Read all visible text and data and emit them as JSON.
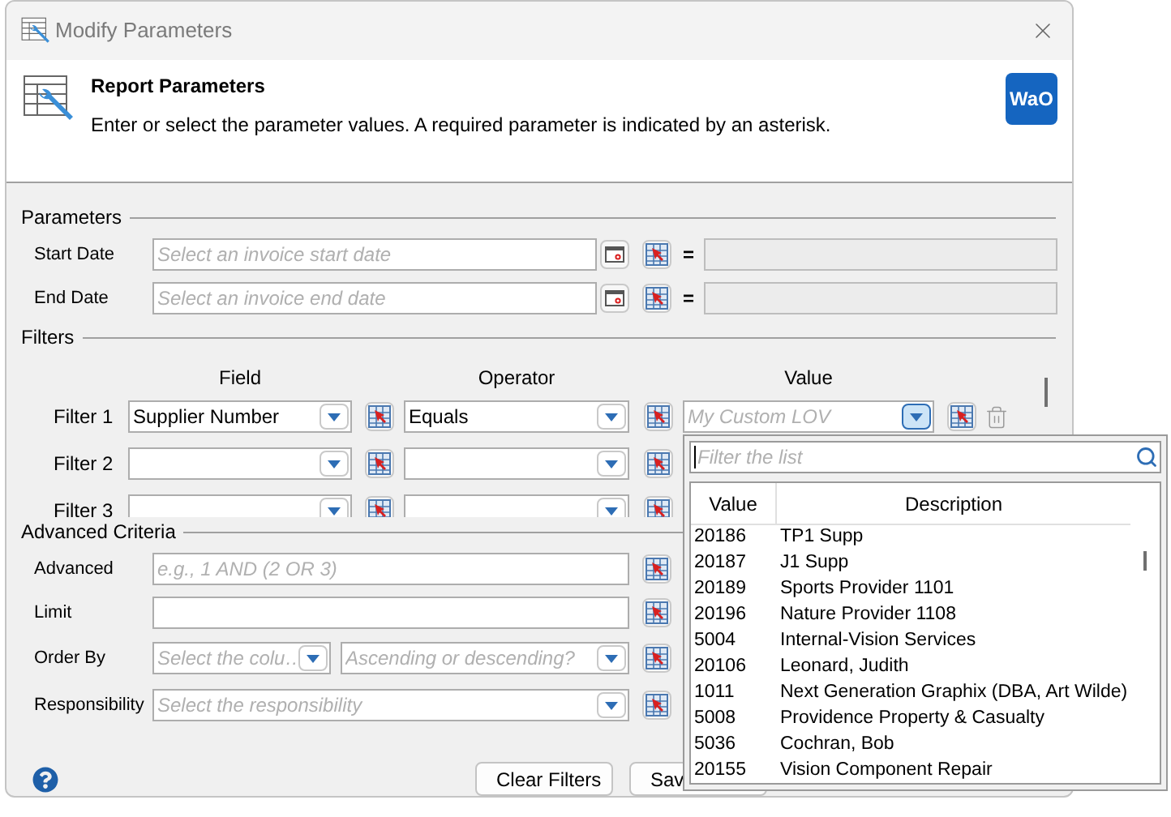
{
  "window": {
    "title": "Modify Parameters"
  },
  "header": {
    "title": "Report Parameters",
    "description": "Enter or select the parameter values. A required parameter is indicated by an asterisk.",
    "logo": "WaO"
  },
  "parameters": {
    "label": "Parameters",
    "rows": [
      {
        "label": "Start Date",
        "placeholder": "Select an invoice start date",
        "operator": "="
      },
      {
        "label": "End Date",
        "placeholder": "Select an invoice end date",
        "operator": "="
      }
    ]
  },
  "filters": {
    "label": "Filters",
    "columns": [
      "Field",
      "Operator",
      "Value"
    ],
    "rows": [
      {
        "label": "Filter 1",
        "field": "Supplier Number",
        "operator": "Equals",
        "value_placeholder": "My Custom LOV",
        "dropdown_open": true
      },
      {
        "label": "Filter 2"
      },
      {
        "label": "Filter 3"
      }
    ]
  },
  "advanced": {
    "label": "Advanced Criteria",
    "rows": [
      {
        "kind": "text",
        "label": "Advanced",
        "placeholder": "e.g., 1 AND (2 OR 3)"
      },
      {
        "kind": "text",
        "label": "Limit"
      },
      {
        "kind": "order",
        "label": "Order By",
        "placeholders": [
          "Select the colu…",
          "Ascending or descending?"
        ]
      },
      {
        "kind": "select",
        "label": "Responsibility",
        "placeholder": "Select the responsibility"
      }
    ]
  },
  "buttons": [
    "Clear Filters",
    "Sav"
  ],
  "lov_popup": {
    "filter_placeholder": "Filter the list",
    "columns": [
      "Value",
      "Description"
    ],
    "rows": [
      {
        "value": "20186",
        "description": "TP1 Supp"
      },
      {
        "value": "20187",
        "description": "J1 Supp"
      },
      {
        "value": "20189",
        "description": "Sports Provider 1101"
      },
      {
        "value": "20196",
        "description": "Nature Provider 1108"
      },
      {
        "value": "5004",
        "description": "Internal-Vision Services"
      },
      {
        "value": "20106",
        "description": "Leonard, Judith"
      },
      {
        "value": "1011",
        "description": "Next Generation Graphix (DBA, Art Wilde)"
      },
      {
        "value": "5008",
        "description": "Providence Property & Casualty"
      },
      {
        "value": "5036",
        "description": "Cochran, Bob"
      },
      {
        "value": "20155",
        "description": "Vision Component Repair"
      }
    ]
  }
}
